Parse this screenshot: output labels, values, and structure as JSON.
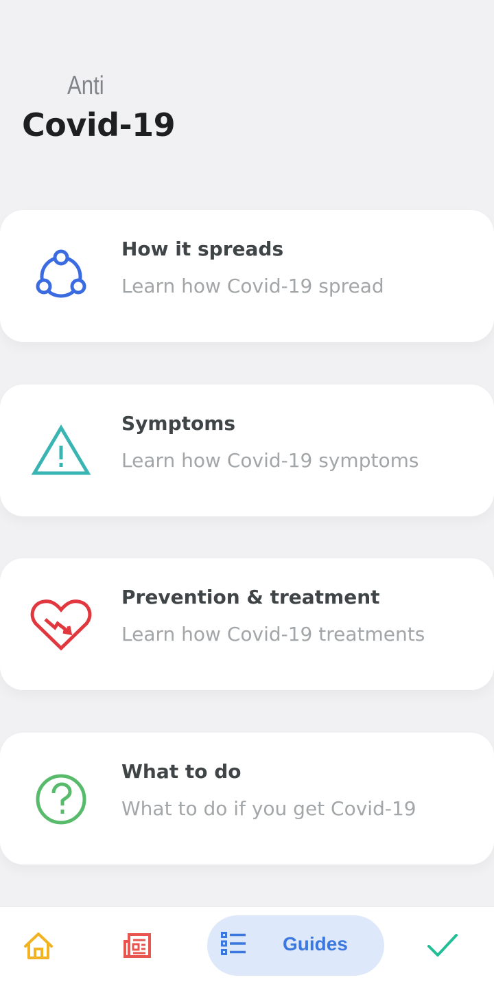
{
  "header": {
    "subtitle": "Anti",
    "title": "Covid-19"
  },
  "cards": [
    {
      "icon": "share-network-icon",
      "color": "#3a6be0",
      "title": "How it spreads",
      "description": "Learn how Covid-19 spread"
    },
    {
      "icon": "warning-triangle-icon",
      "color": "#3ab3b3",
      "title": "Symptoms",
      "description": "Learn how Covid-19 symptoms"
    },
    {
      "icon": "broken-heart-icon",
      "color": "#e0383e",
      "title": "Prevention & treatment",
      "description": "Learn how Covid-19 treatments"
    },
    {
      "icon": "question-circle-icon",
      "color": "#58bb6b",
      "title": "What to do",
      "description": "What to do if you get Covid-19"
    }
  ],
  "bottom_nav": {
    "home": {
      "icon": "home-icon",
      "color": "#f2b322"
    },
    "news": {
      "icon": "newspaper-icon",
      "color": "#e8554e"
    },
    "guides": {
      "icon": "list-icon",
      "label": "Guides",
      "color": "#3a78e0",
      "active": true
    },
    "check": {
      "icon": "checkmark-icon",
      "color": "#22bf96"
    }
  }
}
